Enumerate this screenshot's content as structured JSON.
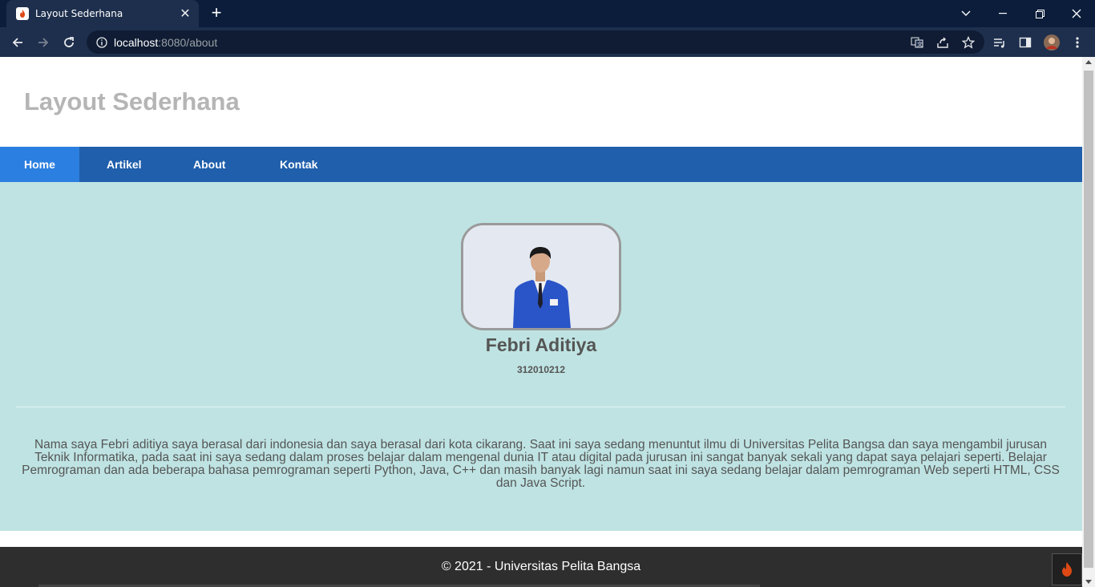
{
  "browser": {
    "tab_title": "Layout Sederhana",
    "url_host": "localhost",
    "url_rest": ":8080/about",
    "window_controls": [
      "chevron-down-icon",
      "minimize-icon",
      "restore-icon",
      "close-icon"
    ],
    "toolbar_icons": [
      "translate-icon",
      "share-icon",
      "star-icon",
      "playlist-icon",
      "sidebar-icon",
      "avatar",
      "more-icon"
    ]
  },
  "site": {
    "title": "Layout Sederhana"
  },
  "nav": {
    "items": [
      {
        "label": "Home"
      },
      {
        "label": "Artikel"
      },
      {
        "label": "About"
      },
      {
        "label": "Kontak"
      }
    ]
  },
  "profile": {
    "name": "Febri Aditiya",
    "nim": "312010212",
    "bio": "Nama saya Febri aditiya saya berasal dari indonesia dan saya berasal dari kota cikarang. Saat ini saya sedang menuntut ilmu di Universitas Pelita Bangsa dan saya mengambil jurusan Teknik Informatika, pada saat ini saya sedang dalam proses belajar dalam mengenal dunia IT atau digital pada jurusan ini sangat banyak sekali yang dapat saya pelajari seperti. Belajar Pemrograman dan ada beberapa bahasa pemrograman seperti Python, Java, C++ dan masih banyak lagi namun saat ini saya sedang belajar dalam pemrograman Web seperti HTML, CSS dan Java Script."
  },
  "footer": {
    "text": "© 2021 - Universitas Pelita Bangsa"
  },
  "colors": {
    "navbar": "#1f5fac",
    "nav_active": "#2b7fe0",
    "content_bg": "#bfe3e3",
    "footer_bg": "#2e2e2e",
    "title_gray": "#b5b5b5"
  }
}
